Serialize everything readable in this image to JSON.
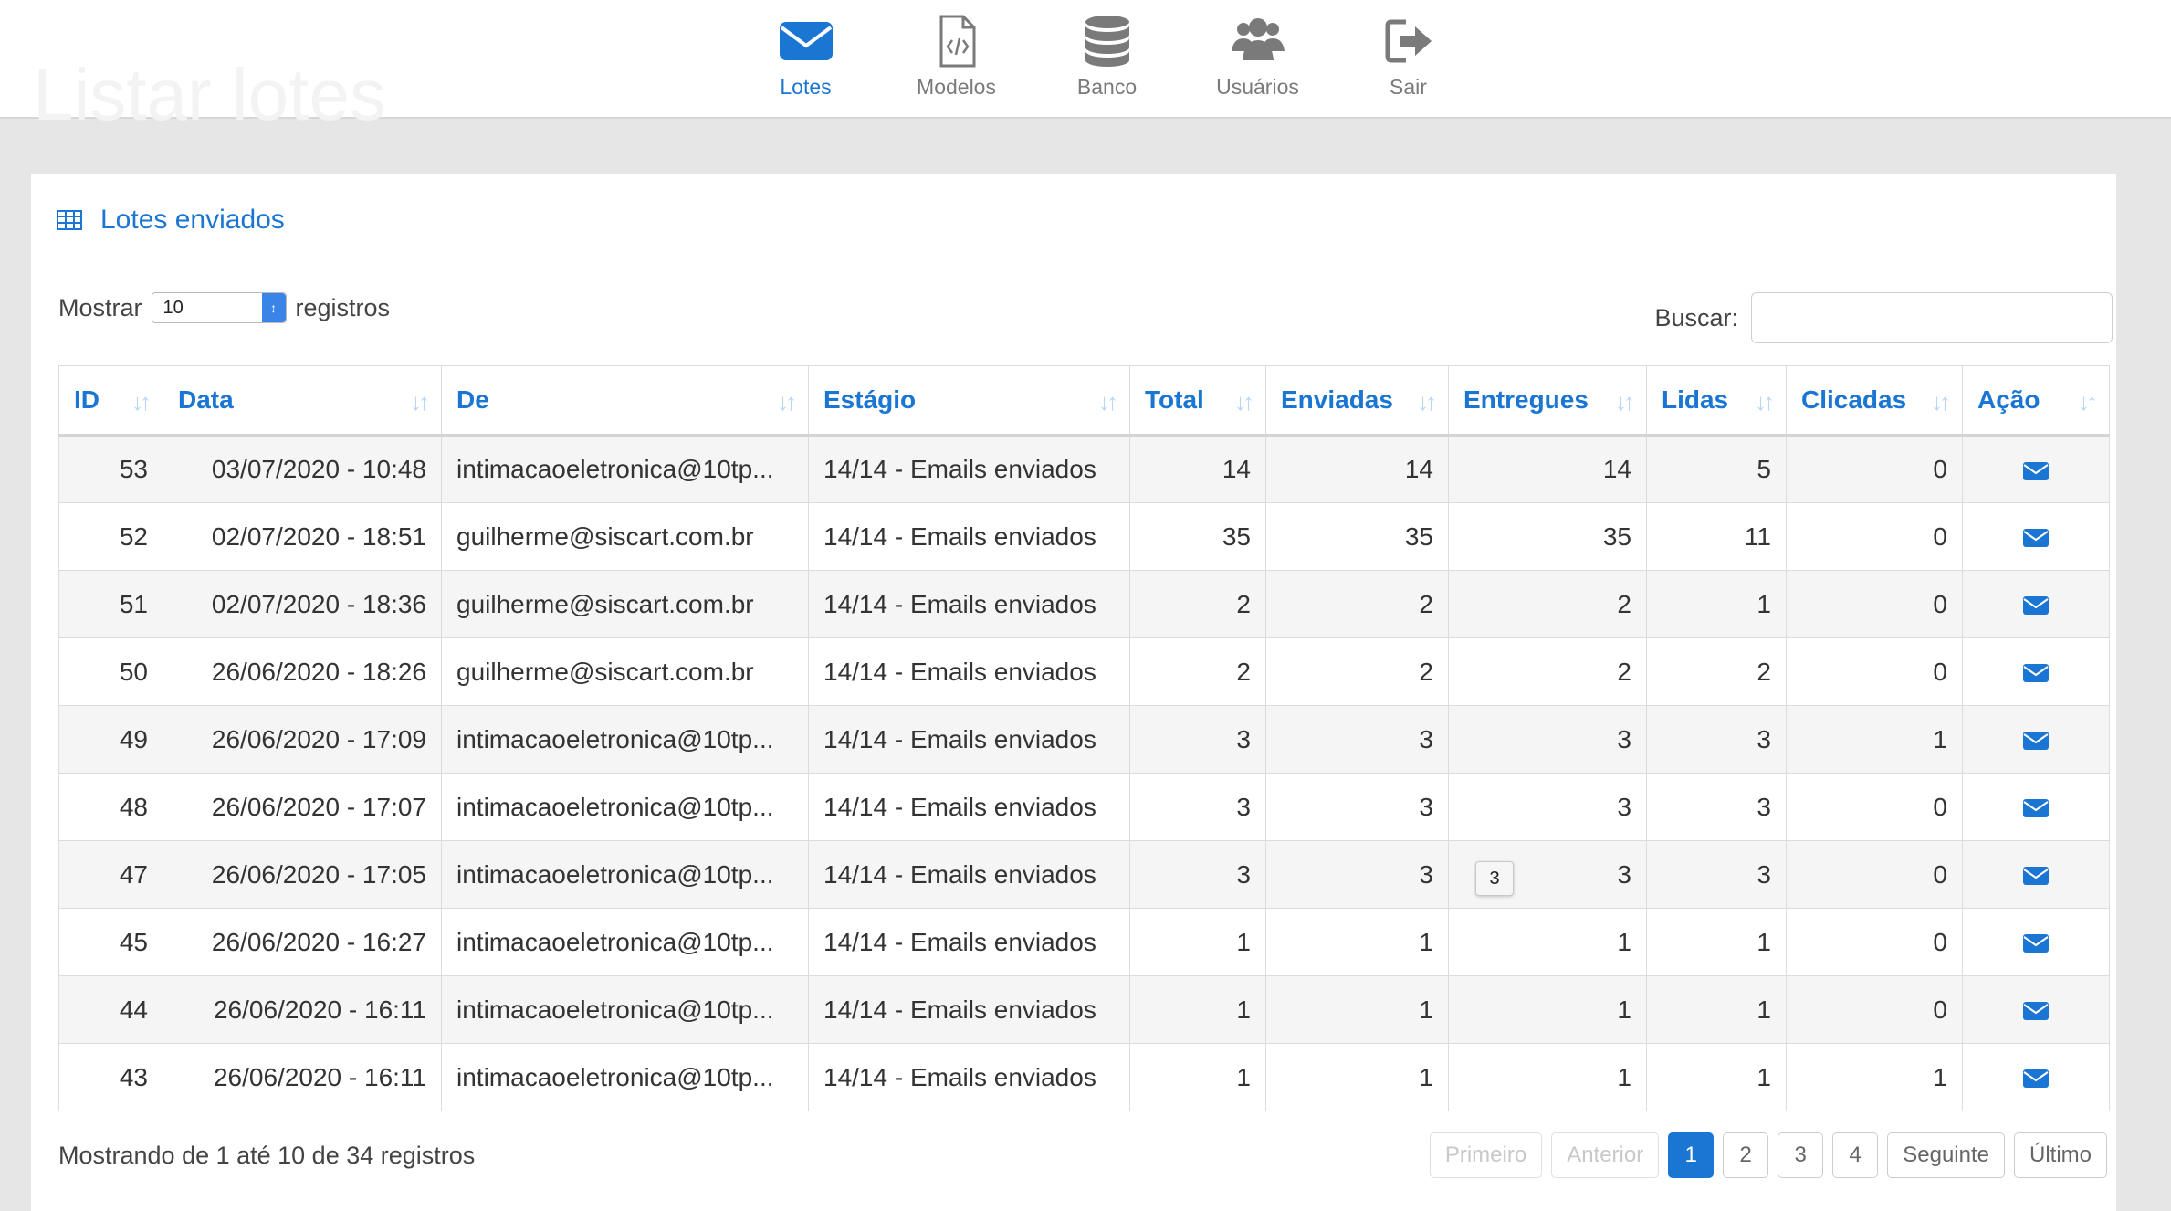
{
  "ghost_title": "Listar lotes",
  "nav": [
    {
      "label": "Lotes",
      "icon": "envelope-icon",
      "active": true
    },
    {
      "label": "Modelos",
      "icon": "file-code-icon",
      "active": false
    },
    {
      "label": "Banco",
      "icon": "database-icon",
      "active": false
    },
    {
      "label": "Usuários",
      "icon": "users-icon",
      "active": false
    },
    {
      "label": "Sair",
      "icon": "sign-out-icon",
      "active": false
    }
  ],
  "colors": {
    "accent": "#1a76d2",
    "nav_inactive": "#7a7a7a",
    "row_stripe": "#f5f5f5"
  },
  "panel": {
    "title": "Lotes enviados",
    "title_icon": "table-icon"
  },
  "length": {
    "label_before": "Mostrar",
    "value": "10",
    "label_after": "registros"
  },
  "search": {
    "label": "Buscar:",
    "value": "",
    "placeholder": ""
  },
  "table": {
    "columns": [
      "ID",
      "Data",
      "De",
      "Estágio",
      "Total",
      "Enviadas",
      "Entregues",
      "Lidas",
      "Clicadas",
      "Ação"
    ],
    "rows": [
      {
        "id": "53",
        "data": "03/07/2020 - 10:48",
        "de": "intimacaoeletronica@10tp...",
        "estagio": "14/14 - Emails enviados",
        "total": "14",
        "enviadas": "14",
        "entregues": "14",
        "lidas": "5",
        "clicadas": "0"
      },
      {
        "id": "52",
        "data": "02/07/2020 - 18:51",
        "de": "guilherme@siscart.com.br",
        "estagio": "14/14 - Emails enviados",
        "total": "35",
        "enviadas": "35",
        "entregues": "35",
        "lidas": "11",
        "clicadas": "0"
      },
      {
        "id": "51",
        "data": "02/07/2020 - 18:36",
        "de": "guilherme@siscart.com.br",
        "estagio": "14/14 - Emails enviados",
        "total": "2",
        "enviadas": "2",
        "entregues": "2",
        "lidas": "1",
        "clicadas": "0"
      },
      {
        "id": "50",
        "data": "26/06/2020 - 18:26",
        "de": "guilherme@siscart.com.br",
        "estagio": "14/14 - Emails enviados",
        "total": "2",
        "enviadas": "2",
        "entregues": "2",
        "lidas": "2",
        "clicadas": "0"
      },
      {
        "id": "49",
        "data": "26/06/2020 - 17:09",
        "de": "intimacaoeletronica@10tp...",
        "estagio": "14/14 - Emails enviados",
        "total": "3",
        "enviadas": "3",
        "entregues": "3",
        "lidas": "3",
        "clicadas": "1"
      },
      {
        "id": "48",
        "data": "26/06/2020 - 17:07",
        "de": "intimacaoeletronica@10tp...",
        "estagio": "14/14 - Emails enviados",
        "total": "3",
        "enviadas": "3",
        "entregues": "3",
        "lidas": "3",
        "clicadas": "0"
      },
      {
        "id": "47",
        "data": "26/06/2020 - 17:05",
        "de": "intimacaoeletronica@10tp...",
        "estagio": "14/14 - Emails enviados",
        "total": "3",
        "enviadas": "3",
        "entregues": "3",
        "lidas": "3",
        "clicadas": "0"
      },
      {
        "id": "45",
        "data": "26/06/2020 - 16:27",
        "de": "intimacaoeletronica@10tp...",
        "estagio": "14/14 - Emails enviados",
        "total": "1",
        "enviadas": "1",
        "entregues": "1",
        "lidas": "1",
        "clicadas": "0"
      },
      {
        "id": "44",
        "data": "26/06/2020 - 16:11",
        "de": "intimacaoeletronica@10tp...",
        "estagio": "14/14 - Emails enviados",
        "total": "1",
        "enviadas": "1",
        "entregues": "1",
        "lidas": "1",
        "clicadas": "0"
      },
      {
        "id": "43",
        "data": "26/06/2020 - 16:11",
        "de": "intimacaoeletronica@10tp...",
        "estagio": "14/14 - Emails enviados",
        "total": "1",
        "enviadas": "1",
        "entregues": "1",
        "lidas": "1",
        "clicadas": "1"
      }
    ],
    "action_icon": "envelope-icon"
  },
  "tooltip": "3",
  "info": "Mostrando de 1 até 10 de 34 registros",
  "pagination": {
    "first": "Primeiro",
    "prev": "Anterior",
    "pages": [
      "1",
      "2",
      "3",
      "4"
    ],
    "current": "1",
    "next": "Seguinte",
    "last": "Último"
  }
}
